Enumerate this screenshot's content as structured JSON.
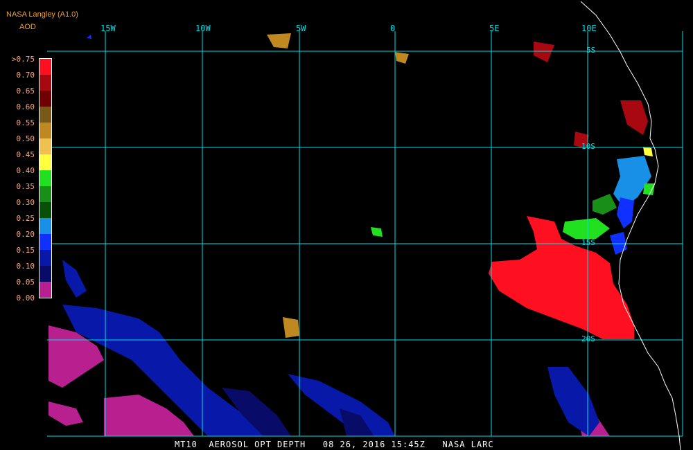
{
  "header": {
    "title": "NASA Langley (A1.0)",
    "variable": "AOD"
  },
  "legend": {
    "labels": [
      ">0.75",
      "0.70",
      "0.65",
      "0.60",
      "0.55",
      "0.50",
      "0.45",
      "0.40",
      "0.35",
      "0.30",
      "0.25",
      "0.20",
      "0.15",
      "0.10",
      "0.05",
      "0.00"
    ],
    "colors": [
      "#ff1020",
      "#a80810",
      "#700000",
      "#7a5818",
      "#c08820",
      "#f0c050",
      "#ffff40",
      "#20e020",
      "#189018",
      "#085008",
      "#1890e8",
      "#1030ff",
      "#0818a8",
      "#080c68",
      "#b82090"
    ]
  },
  "grid": {
    "longitudes": [
      "15W",
      "10W",
      "5W",
      "0",
      "5E",
      "10E"
    ],
    "latitudes": [
      "5S",
      "10S",
      "15S",
      "20S"
    ],
    "line_color": "#00e0e8"
  },
  "footer": {
    "text": "MT10  AEROSOL OPT DEPTH   08 26, 2016 15:45Z   NASA LARC"
  }
}
